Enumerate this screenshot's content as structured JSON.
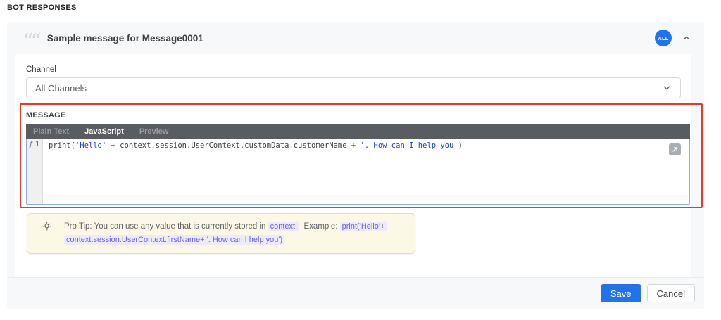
{
  "page": {
    "heading": "BOT RESPONSES"
  },
  "card": {
    "title": "Sample message for Message0001",
    "badge": "ALL",
    "channel": {
      "label": "Channel",
      "value": "All Channels"
    },
    "message": {
      "label": "MESSAGE",
      "tabs": [
        {
          "label": "Plain Text"
        },
        {
          "label": "JavaScript"
        },
        {
          "label": "Preview"
        }
      ],
      "editor": {
        "fold_marker": "ƒ",
        "line_number": "1",
        "code_tokens": [
          {
            "t": "print("
          },
          {
            "t": "'Hello'"
          },
          {
            "t": " + "
          },
          {
            "t": "context.session.UserContext.customData.customerName"
          },
          {
            "t": " + "
          },
          {
            "t": "'. How can I help you'"
          },
          {
            "t": ")"
          }
        ]
      }
    },
    "pro_tip": {
      "prefix": "Pro Tip: You can use any value that is currently stored in",
      "context_chip": "context.",
      "example_label": "Example:",
      "example_code_line1": "print('Hello'+",
      "example_code_line2": "context.session.UserContext.firstName+ '. How can I help you')"
    },
    "footer": {
      "save": "Save",
      "cancel": "Cancel"
    }
  },
  "colors": {
    "annotation_red": "#e8382a",
    "badge_blue": "#1f74f2",
    "save_blue": "#2272ea",
    "tabbar_gray": "#595c60",
    "protip_bg": "#fcf8e6",
    "string_blue": "#1d46cf"
  }
}
